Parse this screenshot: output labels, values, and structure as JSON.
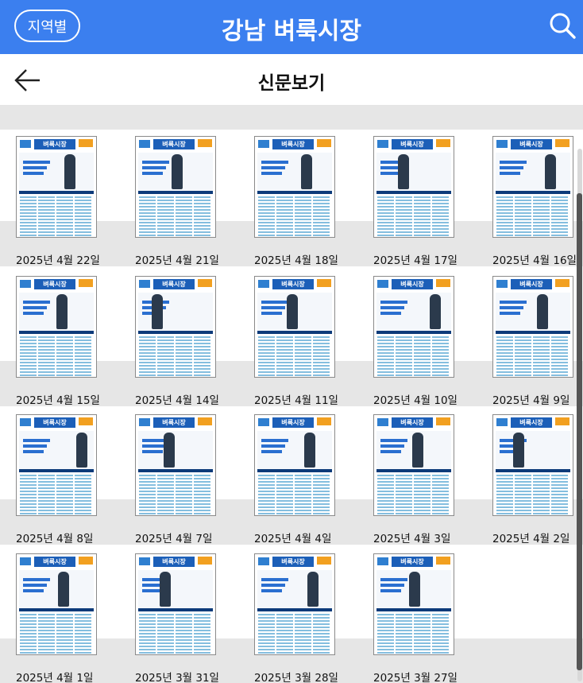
{
  "header": {
    "region_button": "지역별",
    "title": "강남 벼룩시장",
    "search_icon": "search-icon",
    "brand_color": "#3b7fef"
  },
  "subheader": {
    "back_icon": "arrow-left-icon",
    "title": "신문보기"
  },
  "thumbnail_header": "벼룩시장",
  "rows": [
    {
      "items": [
        {
          "label": "2025년 4월 22일"
        },
        {
          "label": "2025년 4월 21일"
        },
        {
          "label": "2025년 4월 18일"
        },
        {
          "label": "2025년 4월 17일"
        },
        {
          "label": "2025년 4월 16일"
        }
      ]
    },
    {
      "items": [
        {
          "label": "2025년 4월 15일"
        },
        {
          "label": "2025년 4월 14일"
        },
        {
          "label": "2025년 4월 11일"
        },
        {
          "label": "2025년 4월 10일"
        },
        {
          "label": "2025년 4월 9일"
        }
      ]
    },
    {
      "items": [
        {
          "label": "2025년 4월 8일"
        },
        {
          "label": "2025년 4월 7일"
        },
        {
          "label": "2025년 4월 4일"
        },
        {
          "label": "2025년 4월 3일"
        },
        {
          "label": "2025년 4월 2일"
        }
      ]
    },
    {
      "items": [
        {
          "label": "2025년 4월 1일"
        },
        {
          "label": "2025년 3월 31일"
        },
        {
          "label": "2025년 3월 28일"
        },
        {
          "label": "2025년 3월 27일"
        }
      ]
    }
  ]
}
